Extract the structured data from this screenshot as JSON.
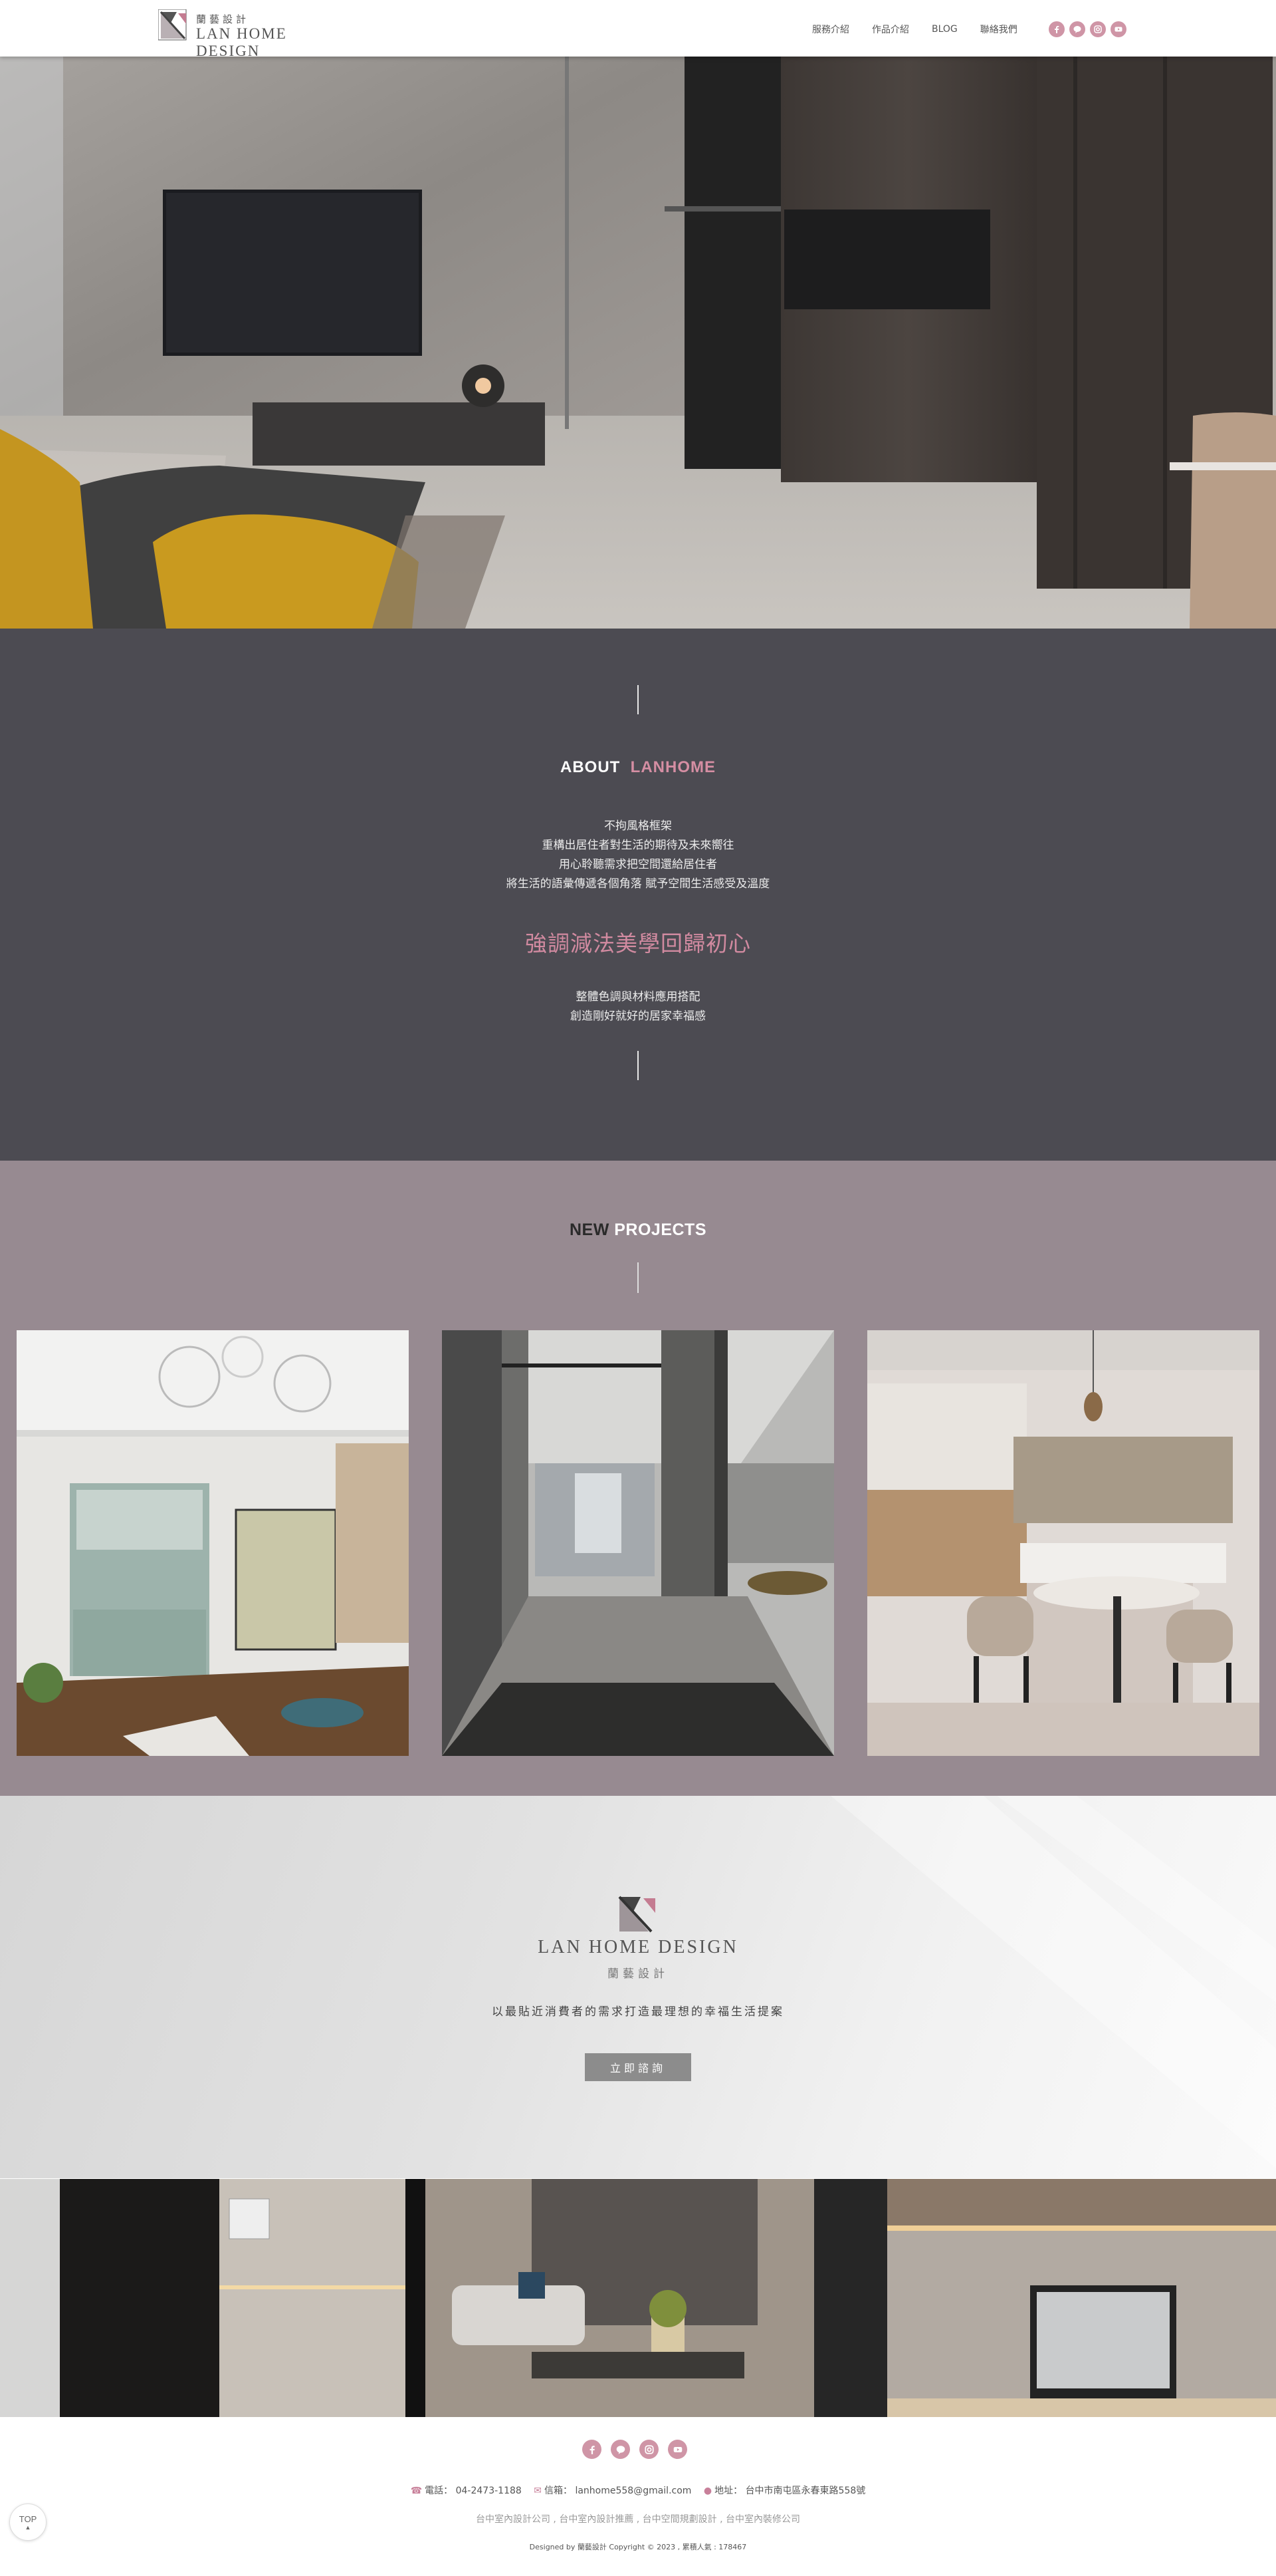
{
  "header": {
    "logo_cn": "蘭藝設計",
    "logo_en": "LAN HOME DESIGN",
    "nav": [
      "服務介紹",
      "作品介紹",
      "BLOG",
      "聯絡我們"
    ],
    "social_icons": [
      "facebook-icon",
      "line-icon",
      "instagram-icon",
      "youtube-icon"
    ]
  },
  "about": {
    "title_a": "ABOUT",
    "title_b": "LANHOME",
    "lines": [
      "不拘風格框架",
      "重構出居住者對生活的期待及未來嚮往",
      "用心聆聽需求把空間還給居住者",
      "將生活的語彙傳遞各個角落 賦予空間生活感受及溫度"
    ],
    "slogan": "強調減法美學回歸初心",
    "lines2": [
      "整體色調與材料應用搭配",
      "創造剛好就好的居家幸福感"
    ]
  },
  "projects": {
    "title_a": "NEW",
    "title_b": "PROJECTS"
  },
  "cta": {
    "logo_en": "LAN HOME DESIGN",
    "logo_cn": "蘭藝設計",
    "text": "以最貼近消費者的需求打造最理想的幸福生活提案",
    "button": "立即諮詢"
  },
  "footer": {
    "phone_label": "電話：",
    "phone": "04-2473-1188",
    "email_label": "信箱：",
    "email": "lanhome558@gmail.com",
    "address_label": "地址：",
    "address": "台中市南屯區永春東路558號",
    "keywords": "台中室內設計公司 , 台中室內設計推薦 , 台中空間規劃設計 , 台中室內裝修公司",
    "copyright": "Designed by 蘭藝設計 Copyright © 2023 , 累積人氣 : 178467",
    "top_label": "TOP",
    "top_arrow": "▲"
  },
  "colors": {
    "accent": "#cf95a6",
    "about_bg": "#4c4b52",
    "projects_bg": "#978a91"
  }
}
